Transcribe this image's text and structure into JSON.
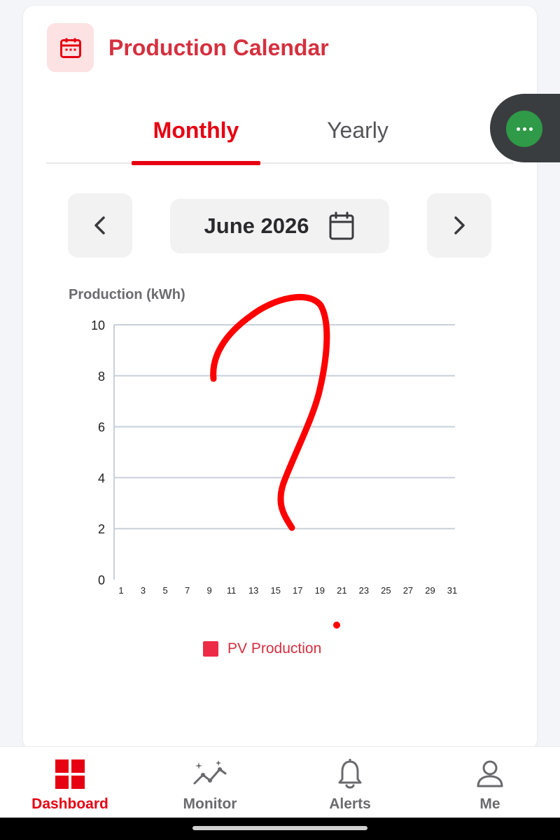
{
  "header": {
    "title": "Production Calendar",
    "icon": "calendar-icon"
  },
  "tabs": [
    {
      "label": "Monthly",
      "active": true
    },
    {
      "label": "Yearly",
      "active": false
    }
  ],
  "period": {
    "label": "June 2026",
    "prev_icon": "chevron-left-icon",
    "next_icon": "chevron-right-icon",
    "picker_icon": "calendar-icon"
  },
  "floating_button": {
    "icon": "more-horizontal-icon",
    "color": "#2f9a47"
  },
  "chart_data": {
    "type": "bar",
    "ylabel": "Production (kWh)",
    "ylim": [
      0,
      10
    ],
    "yticks": [
      0,
      2,
      4,
      6,
      8,
      10
    ],
    "xticks": [
      "1",
      "3",
      "5",
      "7",
      "9",
      "11",
      "13",
      "15",
      "17",
      "19",
      "21",
      "23",
      "25",
      "27",
      "29",
      "31"
    ],
    "grid": true,
    "series": [
      {
        "name": "PV Production",
        "color": "#ee2b47",
        "values": []
      }
    ],
    "legend": "bottom-center"
  },
  "annotation": {
    "type": "hand-drawn-question-mark",
    "color": "#ff0000"
  },
  "bottom_nav": [
    {
      "label": "Dashboard",
      "icon": "dashboard-grid-icon",
      "active": true
    },
    {
      "label": "Monitor",
      "icon": "monitor-chart-icon",
      "active": false
    },
    {
      "label": "Alerts",
      "icon": "bell-icon",
      "active": false
    },
    {
      "label": "Me",
      "icon": "person-icon",
      "active": false
    }
  ],
  "colors": {
    "brand": "#e60012",
    "title": "#d5303f",
    "grid": "#c8d0db"
  }
}
